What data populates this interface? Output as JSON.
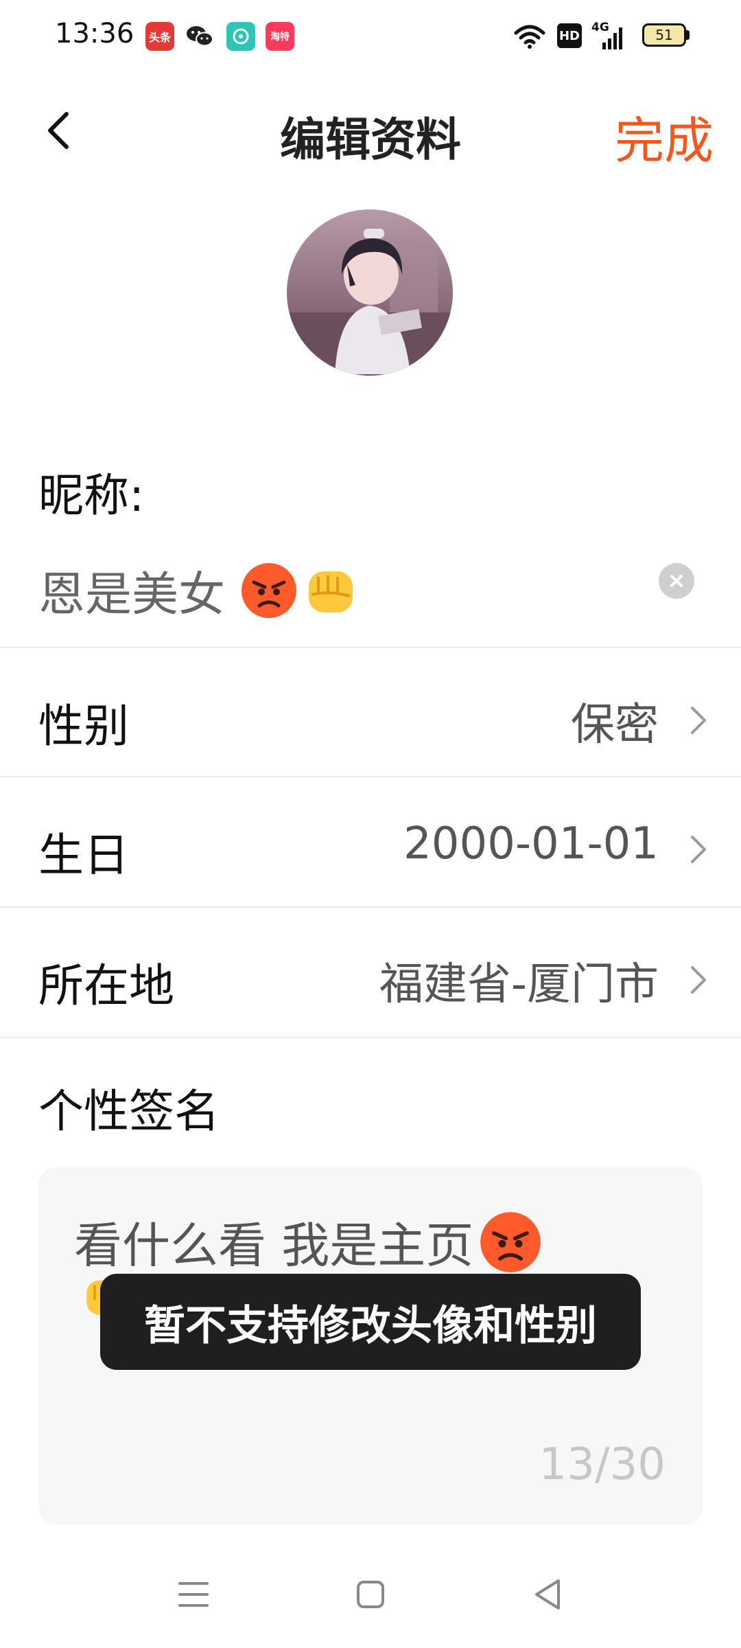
{
  "status_bar": {
    "time": "13:36",
    "app_icons": [
      {
        "name": "toutiao-icon",
        "label": "头条",
        "color": "#e53935"
      },
      {
        "name": "wechat-icon",
        "color": "#222222"
      },
      {
        "name": "music-app-icon",
        "color": "#2ec4b6"
      },
      {
        "name": "taote-icon",
        "label": "淘特",
        "color": "#ff3a5a"
      }
    ],
    "network": "4G",
    "hd": "HD",
    "battery": "51"
  },
  "header": {
    "title": "编辑资料",
    "done_label": "完成",
    "accent_color": "#f2571f"
  },
  "profile": {
    "nickname_label": "昵称:",
    "nickname_value": "恩是美女"
  },
  "rows": [
    {
      "label": "性别",
      "value": "保密"
    },
    {
      "label": "生日",
      "value": "2000-01-01"
    },
    {
      "label": "所在地",
      "value": "福建省-厦门市"
    }
  ],
  "signature": {
    "label": "个性签名",
    "text": "看什么看 我是主页",
    "counter": "13/30"
  },
  "toast": {
    "message": "暂不支持修改头像和性别"
  }
}
